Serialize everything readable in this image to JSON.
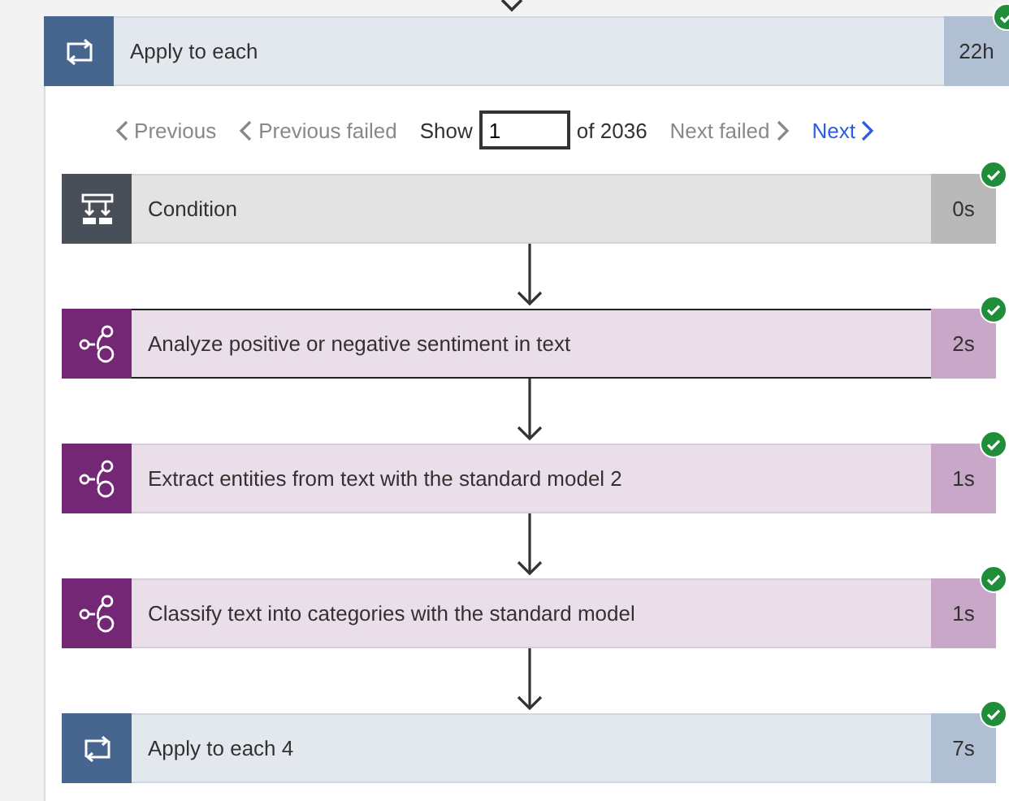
{
  "loop": {
    "title": "Apply to each",
    "duration": "22h",
    "succeeded": true
  },
  "pager": {
    "previous": {
      "label": "Previous",
      "disabled": true
    },
    "previous_failed": {
      "label": "Previous failed",
      "disabled": true
    },
    "show_label": "Show",
    "value": "1",
    "total": "of 2036",
    "next_failed": {
      "label": "Next failed",
      "disabled": true
    },
    "next": {
      "label": "Next",
      "disabled": false
    }
  },
  "steps": [
    {
      "kind": "condition",
      "title": "Condition",
      "duration": "0s",
      "succeeded": true,
      "selected": false
    },
    {
      "kind": "ai",
      "title": "Analyze positive or negative sentiment in text",
      "duration": "2s",
      "succeeded": true,
      "selected": true
    },
    {
      "kind": "ai",
      "title": "Extract entities from text with the standard model 2",
      "duration": "1s",
      "succeeded": true,
      "selected": false
    },
    {
      "kind": "ai",
      "title": "Classify text into categories with the standard model",
      "duration": "1s",
      "succeeded": true,
      "selected": false
    },
    {
      "kind": "loop",
      "title": "Apply to each 4",
      "duration": "7s",
      "succeeded": true,
      "selected": false
    }
  ]
}
